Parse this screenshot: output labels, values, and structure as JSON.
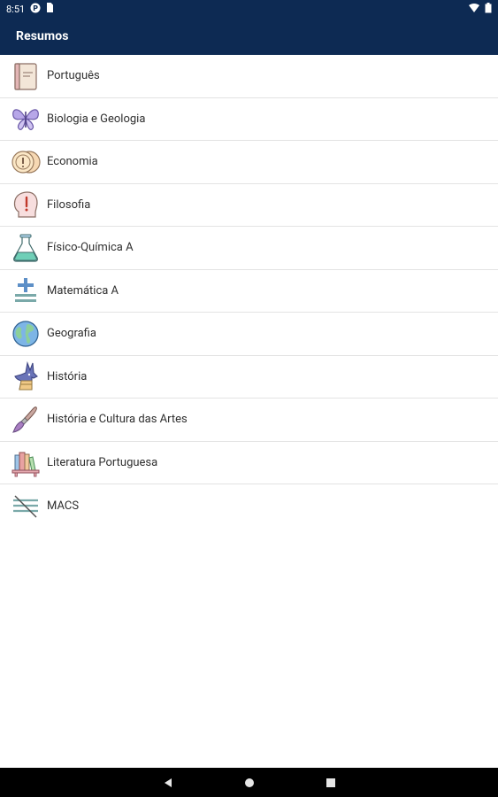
{
  "status": {
    "time": "8:51"
  },
  "app": {
    "title": "Resumos"
  },
  "subjects": [
    {
      "label": "Português",
      "icon": "book-icon"
    },
    {
      "label": "Biologia e Geologia",
      "icon": "butterfly-icon"
    },
    {
      "label": "Economia",
      "icon": "coins-icon"
    },
    {
      "label": "Filosofia",
      "icon": "head-exclamation-icon"
    },
    {
      "label": "Físico-Química A",
      "icon": "flask-icon"
    },
    {
      "label": "Matemática A",
      "icon": "math-symbols-icon"
    },
    {
      "label": "Geografia",
      "icon": "globe-icon"
    },
    {
      "label": "História",
      "icon": "anubis-icon"
    },
    {
      "label": "História e Cultura das Artes",
      "icon": "paintbrush-icon"
    },
    {
      "label": "Literatura Portuguesa",
      "icon": "bookshelf-icon"
    },
    {
      "label": "MACS",
      "icon": "parallel-lines-icon"
    }
  ],
  "colors": {
    "primary": "#0d2a53",
    "divider": "#e3e3e3",
    "text": "#2f2f2f"
  }
}
